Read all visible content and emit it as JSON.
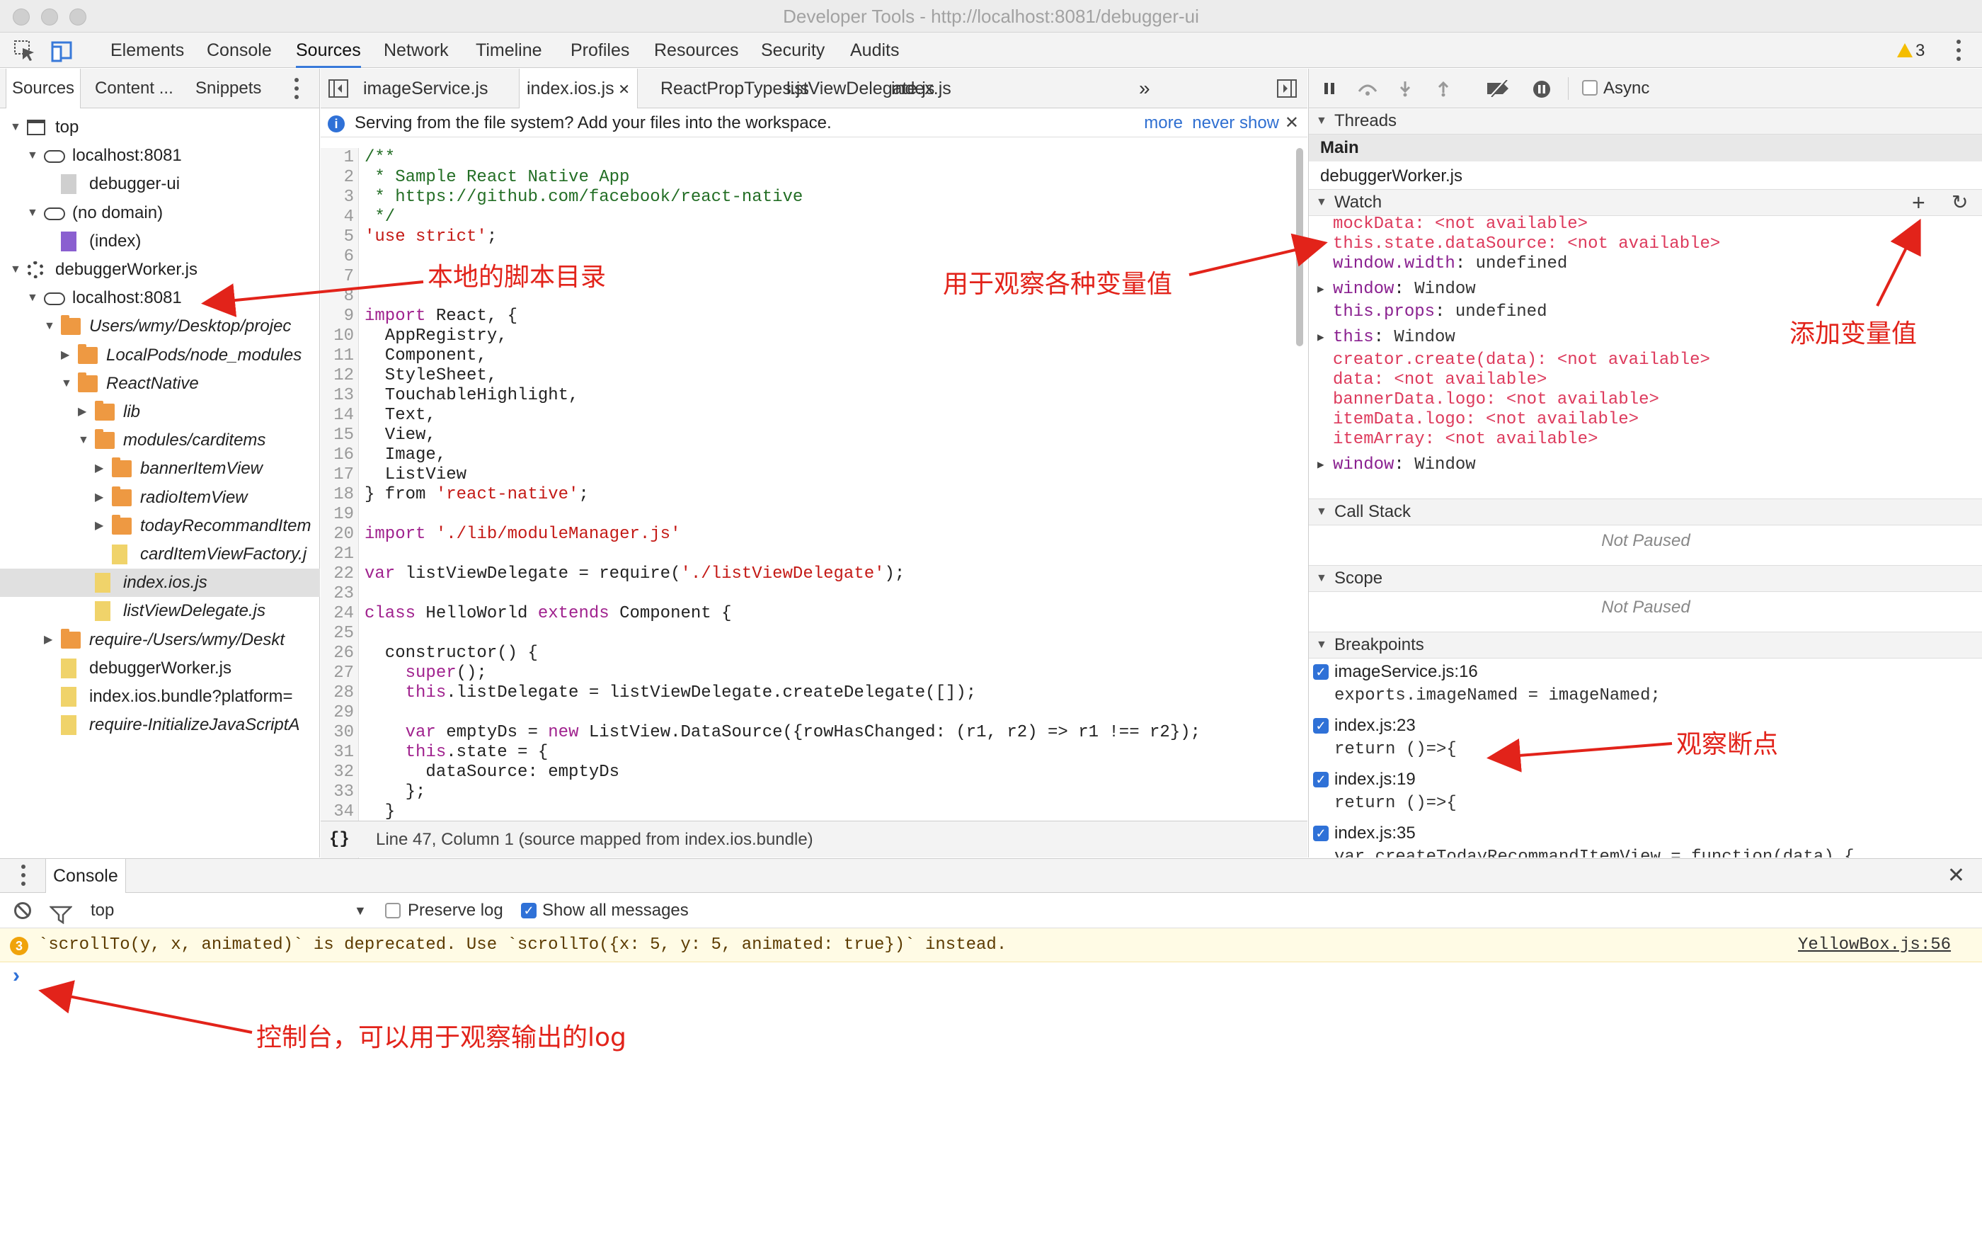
{
  "window": {
    "title": "Developer Tools - http://localhost:8081/debugger-ui"
  },
  "main_tabs": [
    "Elements",
    "Console",
    "Sources",
    "Network",
    "Timeline",
    "Profiles",
    "Resources",
    "Security",
    "Audits"
  ],
  "selected_main_tab": "Sources",
  "warning_count": "3",
  "navigator": {
    "tabs": [
      "Sources",
      "Content ...",
      "Snippets"
    ],
    "tree": [
      {
        "label": "top",
        "icon": "frame-icon",
        "depth": 0,
        "toggle": "open",
        "italic": false
      },
      {
        "label": "localhost:8081",
        "icon": "cloud-icon",
        "depth": 1,
        "toggle": "open",
        "italic": false
      },
      {
        "label": "debugger-ui",
        "icon": "file-icon",
        "depth": 2,
        "toggle": "",
        "italic": false
      },
      {
        "label": "(no domain)",
        "icon": "cloud-icon",
        "depth": 1,
        "toggle": "open",
        "italic": false
      },
      {
        "label": "(index)",
        "icon": "purple-file-icon",
        "depth": 2,
        "toggle": "",
        "italic": false
      },
      {
        "label": "debuggerWorker.js",
        "icon": "gear-icon",
        "depth": 0,
        "toggle": "open",
        "italic": false
      },
      {
        "label": "localhost:8081",
        "icon": "cloud-icon",
        "depth": 1,
        "toggle": "open",
        "italic": false
      },
      {
        "label": "Users/wmy/Desktop/projec",
        "icon": "folder-icon",
        "depth": 2,
        "toggle": "open",
        "italic": true
      },
      {
        "label": "LocalPods/node_modules",
        "icon": "folder-icon",
        "depth": 3,
        "toggle": "closed",
        "italic": true
      },
      {
        "label": "ReactNative",
        "icon": "folder-icon",
        "depth": 3,
        "toggle": "open",
        "italic": true
      },
      {
        "label": "lib",
        "icon": "folder-icon",
        "depth": 4,
        "toggle": "closed",
        "italic": true
      },
      {
        "label": "modules/carditems",
        "icon": "folder-icon",
        "depth": 4,
        "toggle": "open",
        "italic": true
      },
      {
        "label": "bannerItemView",
        "icon": "folder-icon",
        "depth": 5,
        "toggle": "closed",
        "italic": true
      },
      {
        "label": "radioItemView",
        "icon": "folder-icon",
        "depth": 5,
        "toggle": "closed",
        "italic": true
      },
      {
        "label": "todayRecommandItem",
        "icon": "folder-icon",
        "depth": 5,
        "toggle": "closed",
        "italic": true
      },
      {
        "label": "cardItemViewFactory.j",
        "icon": "js-file-icon",
        "depth": 5,
        "toggle": "",
        "italic": true
      },
      {
        "label": "index.ios.js",
        "icon": "js-file-icon",
        "depth": 4,
        "toggle": "",
        "italic": true,
        "selected": true
      },
      {
        "label": "listViewDelegate.js",
        "icon": "js-file-icon",
        "depth": 4,
        "toggle": "",
        "italic": true
      },
      {
        "label": "require-/Users/wmy/Deskt",
        "icon": "folder-icon",
        "depth": 2,
        "toggle": "closed",
        "italic": true
      },
      {
        "label": "debuggerWorker.js",
        "icon": "js-file-icon",
        "depth": 2,
        "toggle": "",
        "italic": false
      },
      {
        "label": "index.ios.bundle?platform=",
        "icon": "js-file-icon",
        "depth": 2,
        "toggle": "",
        "italic": false
      },
      {
        "label": "require-InitializeJavaScriptA",
        "icon": "js-file-icon",
        "depth": 2,
        "toggle": "",
        "italic": true
      }
    ]
  },
  "editor": {
    "tabs": [
      "imageService.js",
      "index.ios.js",
      "ReactPropTypes.js",
      "listViewDelegate.js",
      "index.js"
    ],
    "selected_tab": "index.ios.js",
    "more_tabs": "»",
    "info": {
      "message": "Serving from the file system? Add your files into the workspace.",
      "more": "more",
      "never_show": "never show"
    },
    "lines": [
      [
        [
          "c",
          "/**"
        ]
      ],
      [
        [
          "c",
          " * Sample React Native App"
        ]
      ],
      [
        [
          "c",
          " * https://github.com/facebook/react-native"
        ]
      ],
      [
        [
          "c",
          " */"
        ]
      ],
      [
        [
          "s",
          "'use strict'"
        ],
        [
          "p",
          ";"
        ]
      ],
      [
        [
          "p",
          ""
        ]
      ],
      [
        [
          "p",
          ""
        ]
      ],
      [
        [
          "p",
          ""
        ]
      ],
      [
        [
          "k",
          "import"
        ],
        [
          "p",
          " React, {"
        ]
      ],
      [
        [
          "p",
          "  AppRegistry,"
        ]
      ],
      [
        [
          "p",
          "  Component,"
        ]
      ],
      [
        [
          "p",
          "  StyleSheet,"
        ]
      ],
      [
        [
          "p",
          "  TouchableHighlight,"
        ]
      ],
      [
        [
          "p",
          "  Text,"
        ]
      ],
      [
        [
          "p",
          "  View,"
        ]
      ],
      [
        [
          "p",
          "  Image,"
        ]
      ],
      [
        [
          "p",
          "  ListView"
        ]
      ],
      [
        [
          "p",
          "} from "
        ],
        [
          "s",
          "'react-native'"
        ],
        [
          "p",
          ";"
        ]
      ],
      [
        [
          "p",
          ""
        ]
      ],
      [
        [
          "k",
          "import"
        ],
        [
          "p",
          " "
        ],
        [
          "s",
          "'./lib/moduleManager.js'"
        ]
      ],
      [
        [
          "p",
          ""
        ]
      ],
      [
        [
          "k",
          "var"
        ],
        [
          "p",
          " listViewDelegate = require("
        ],
        [
          "s",
          "'./listViewDelegate'"
        ],
        [
          "p",
          ");"
        ]
      ],
      [
        [
          "p",
          ""
        ]
      ],
      [
        [
          "k",
          "class"
        ],
        [
          "p",
          " HelloWorld "
        ],
        [
          "k",
          "extends"
        ],
        [
          "p",
          " Component {"
        ]
      ],
      [
        [
          "p",
          ""
        ]
      ],
      [
        [
          "p",
          "  constructor() {"
        ]
      ],
      [
        [
          "p",
          "    "
        ],
        [
          "k",
          "super"
        ],
        [
          "p",
          "();"
        ]
      ],
      [
        [
          "p",
          "    "
        ],
        [
          "k",
          "this"
        ],
        [
          "p",
          ".listDelegate = listViewDelegate.createDelegate([]);"
        ]
      ],
      [
        [
          "p",
          ""
        ]
      ],
      [
        [
          "p",
          "    "
        ],
        [
          "k",
          "var"
        ],
        [
          "p",
          " emptyDs = "
        ],
        [
          "k",
          "new"
        ],
        [
          "p",
          " ListView.DataSource({rowHasChanged: (r1, r2) => r1 !== r2});"
        ]
      ],
      [
        [
          "p",
          "    "
        ],
        [
          "k",
          "this"
        ],
        [
          "p",
          ".state = {"
        ]
      ],
      [
        [
          "p",
          "      dataSource: emptyDs"
        ]
      ],
      [
        [
          "p",
          "    };"
        ]
      ],
      [
        [
          "p",
          "  }"
        ]
      ]
    ],
    "status": "Line 47, Column 1  (source mapped from index.ios.bundle)"
  },
  "debugger": {
    "async_label": "Async",
    "threads": {
      "title": "Threads",
      "items": [
        "Main",
        "debuggerWorker.js"
      ]
    },
    "watch": {
      "title": "Watch",
      "items": [
        {
          "name": "mockData",
          "value": "<not available>",
          "na": true,
          "expand": false
        },
        {
          "name": "this.state.dataSource",
          "value": "<not available>",
          "na": true,
          "expand": false
        },
        {
          "name": "window.width",
          "value": "undefined",
          "na": false,
          "expand": false
        },
        {
          "name": "window",
          "value": "Window",
          "na": false,
          "expand": true
        },
        {
          "name": "this.props",
          "value": "undefined",
          "na": false,
          "expand": false
        },
        {
          "name": "this",
          "value": "Window",
          "na": false,
          "expand": true
        },
        {
          "name": "creator.create(data)",
          "value": "<not available>",
          "na": true,
          "expand": false
        },
        {
          "name": "data",
          "value": "<not available>",
          "na": true,
          "expand": false
        },
        {
          "name": "bannerData.logo",
          "value": "<not available>",
          "na": true,
          "expand": false
        },
        {
          "name": "itemData.logo",
          "value": "<not available>",
          "na": true,
          "expand": false
        },
        {
          "name": "itemArray",
          "value": "<not available>",
          "na": true,
          "expand": false
        },
        {
          "name": "window",
          "value": "Window",
          "na": false,
          "expand": true
        }
      ]
    },
    "call_stack": {
      "title": "Call Stack",
      "status": "Not Paused"
    },
    "scope": {
      "title": "Scope",
      "status": "Not Paused"
    },
    "breakpoints": {
      "title": "Breakpoints",
      "items": [
        {
          "location": "imageService.js:16",
          "code": "exports.imageNamed = imageNamed;"
        },
        {
          "location": "index.js:23",
          "code": "return ()=>{"
        },
        {
          "location": "index.js:19",
          "code": "return ()=>{"
        },
        {
          "location": "index.js:35",
          "code": "var createTodayRecommandItemView = function(data) {"
        }
      ]
    }
  },
  "console": {
    "tab": "Console",
    "context": "top",
    "preserve_log": "Preserve log",
    "show_all": "Show all messages",
    "warning": {
      "count": "3",
      "text": "`scrollTo(y, x, animated)` is deprecated. Use `scrollTo({x: 5, y: 5, animated: true})` instead.",
      "source": "YellowBox.js:56"
    },
    "prompt": "›"
  },
  "annotations": {
    "local_scripts": "本地的脚本目录",
    "watch_vars": "用于观察各种变量值",
    "add_var": "添加变量值",
    "watch_breakpoints": "观察断点",
    "console_log": "控制台，可以用于观察输出的log"
  },
  "colors": {
    "accent": "#3879d9",
    "annotation": "#e2231a",
    "keyword": "#a0228e",
    "string": "#c41a16",
    "comment": "#236e25",
    "not_available": "#dd3a5c"
  }
}
